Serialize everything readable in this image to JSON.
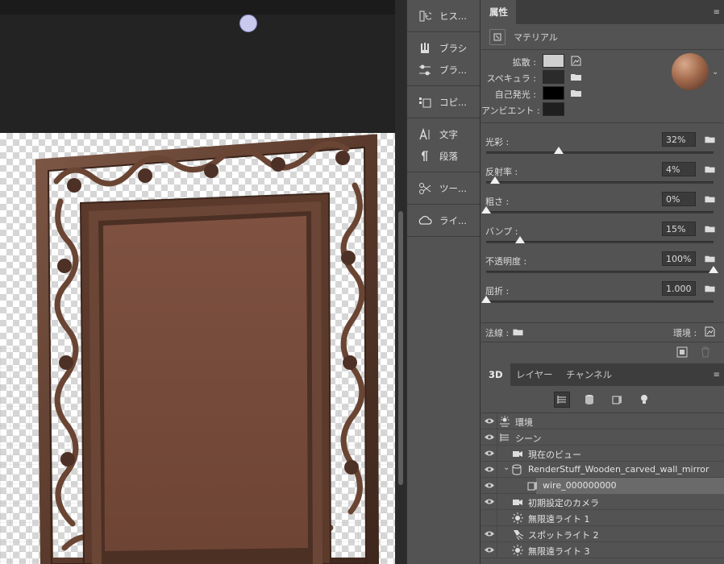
{
  "dock": {
    "groups": [
      {
        "items": [
          {
            "icon": "history-icon",
            "label": "ヒス..."
          }
        ]
      },
      {
        "items": [
          {
            "icon": "brush-icon",
            "label": "ブラシ"
          },
          {
            "icon": "brush-settings-icon",
            "label": "ブラ..."
          }
        ]
      },
      {
        "items": [
          {
            "icon": "clone-source-icon",
            "label": "コピ..."
          }
        ]
      },
      {
        "items": [
          {
            "icon": "character-icon",
            "label": "文字"
          },
          {
            "icon": "paragraph-icon",
            "label": "段落"
          }
        ]
      },
      {
        "items": [
          {
            "icon": "tool-presets-icon",
            "label": "ツー..."
          }
        ]
      },
      {
        "items": [
          {
            "icon": "libraries-icon",
            "label": "ライ..."
          }
        ]
      }
    ]
  },
  "properties": {
    "tab": "属性",
    "header": "マテリアル",
    "swatches": [
      {
        "label": "拡散 :",
        "color": "#cfcfcf"
      },
      {
        "label": "スペキュラ :",
        "color": "#2b2b2b"
      },
      {
        "label": "自己発光 :",
        "color": "#000000"
      },
      {
        "label": "アンビエント :",
        "color": "#1f1f1f"
      }
    ],
    "sliders": [
      {
        "label": "光彩 :",
        "value": "32%",
        "fraction": 0.32
      },
      {
        "label": "反射率 :",
        "value": "4%",
        "fraction": 0.04
      },
      {
        "label": "粗さ :",
        "value": "0%",
        "fraction": 0.0
      },
      {
        "label": "バンプ :",
        "value": "15%",
        "fraction": 0.15
      },
      {
        "label": "不透明度 :",
        "value": "100%",
        "fraction": 1.0
      },
      {
        "label": "屈折 :",
        "value": "1.000",
        "fraction": 0.0
      }
    ],
    "normal_label": "法線 :",
    "environment_label": "環境 :"
  },
  "panel3d": {
    "tabs": [
      "3D",
      "レイヤー",
      "チャンネル"
    ],
    "rows": [
      {
        "label": "環境",
        "icon": "environment-icon",
        "visible": true,
        "indent": 0
      },
      {
        "label": "シーン",
        "icon": "scene-icon",
        "visible": true,
        "indent": 0
      },
      {
        "label": "現在のビュー",
        "icon": "camera-icon",
        "visible": true,
        "indent": 1
      },
      {
        "label": "RenderStuff_Wooden_carved_wall_mirror",
        "icon": "mesh-icon",
        "visible": true,
        "indent": 1,
        "expanded": true
      },
      {
        "label": "wire_000000000",
        "icon": "material-icon",
        "visible": true,
        "indent": 2,
        "selected": true
      },
      {
        "label": "初期設定のカメラ",
        "icon": "camera-icon",
        "visible": true,
        "indent": 1
      },
      {
        "label": "無限遠ライト 1",
        "icon": "infinite-light-icon",
        "visible": false,
        "indent": 1
      },
      {
        "label": "スポットライト 2",
        "icon": "spot-light-icon",
        "visible": true,
        "indent": 1
      },
      {
        "label": "無限遠ライト 3",
        "icon": "infinite-light-icon",
        "visible": true,
        "indent": 1
      }
    ]
  },
  "colors": {
    "panel_bg": "#535353",
    "canvas_dark": "#232323",
    "frame_wood": "#5a3a2c",
    "mirror_fill": "#7a4c3b"
  }
}
